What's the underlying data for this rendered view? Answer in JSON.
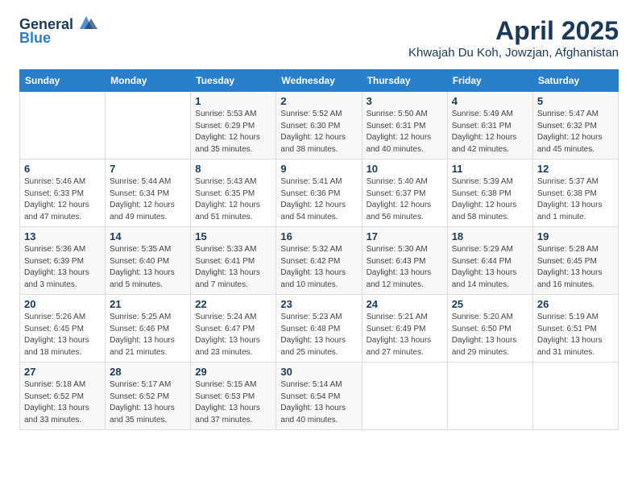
{
  "logo": {
    "general": "General",
    "blue": "Blue"
  },
  "title": {
    "month": "April 2025",
    "location": "Khwajah Du Koh, Jowzjan, Afghanistan"
  },
  "weekdays": [
    "Sunday",
    "Monday",
    "Tuesday",
    "Wednesday",
    "Thursday",
    "Friday",
    "Saturday"
  ],
  "weeks": [
    [
      {
        "day": "",
        "detail": ""
      },
      {
        "day": "",
        "detail": ""
      },
      {
        "day": "1",
        "detail": "Sunrise: 5:53 AM\nSunset: 6:29 PM\nDaylight: 12 hours\nand 35 minutes."
      },
      {
        "day": "2",
        "detail": "Sunrise: 5:52 AM\nSunset: 6:30 PM\nDaylight: 12 hours\nand 38 minutes."
      },
      {
        "day": "3",
        "detail": "Sunrise: 5:50 AM\nSunset: 6:31 PM\nDaylight: 12 hours\nand 40 minutes."
      },
      {
        "day": "4",
        "detail": "Sunrise: 5:49 AM\nSunset: 6:31 PM\nDaylight: 12 hours\nand 42 minutes."
      },
      {
        "day": "5",
        "detail": "Sunrise: 5:47 AM\nSunset: 6:32 PM\nDaylight: 12 hours\nand 45 minutes."
      }
    ],
    [
      {
        "day": "6",
        "detail": "Sunrise: 5:46 AM\nSunset: 6:33 PM\nDaylight: 12 hours\nand 47 minutes."
      },
      {
        "day": "7",
        "detail": "Sunrise: 5:44 AM\nSunset: 6:34 PM\nDaylight: 12 hours\nand 49 minutes."
      },
      {
        "day": "8",
        "detail": "Sunrise: 5:43 AM\nSunset: 6:35 PM\nDaylight: 12 hours\nand 51 minutes."
      },
      {
        "day": "9",
        "detail": "Sunrise: 5:41 AM\nSunset: 6:36 PM\nDaylight: 12 hours\nand 54 minutes."
      },
      {
        "day": "10",
        "detail": "Sunrise: 5:40 AM\nSunset: 6:37 PM\nDaylight: 12 hours\nand 56 minutes."
      },
      {
        "day": "11",
        "detail": "Sunrise: 5:39 AM\nSunset: 6:38 PM\nDaylight: 12 hours\nand 58 minutes."
      },
      {
        "day": "12",
        "detail": "Sunrise: 5:37 AM\nSunset: 6:38 PM\nDaylight: 13 hours\nand 1 minute."
      }
    ],
    [
      {
        "day": "13",
        "detail": "Sunrise: 5:36 AM\nSunset: 6:39 PM\nDaylight: 13 hours\nand 3 minutes."
      },
      {
        "day": "14",
        "detail": "Sunrise: 5:35 AM\nSunset: 6:40 PM\nDaylight: 13 hours\nand 5 minutes."
      },
      {
        "day": "15",
        "detail": "Sunrise: 5:33 AM\nSunset: 6:41 PM\nDaylight: 13 hours\nand 7 minutes."
      },
      {
        "day": "16",
        "detail": "Sunrise: 5:32 AM\nSunset: 6:42 PM\nDaylight: 13 hours\nand 10 minutes."
      },
      {
        "day": "17",
        "detail": "Sunrise: 5:30 AM\nSunset: 6:43 PM\nDaylight: 13 hours\nand 12 minutes."
      },
      {
        "day": "18",
        "detail": "Sunrise: 5:29 AM\nSunset: 6:44 PM\nDaylight: 13 hours\nand 14 minutes."
      },
      {
        "day": "19",
        "detail": "Sunrise: 5:28 AM\nSunset: 6:45 PM\nDaylight: 13 hours\nand 16 minutes."
      }
    ],
    [
      {
        "day": "20",
        "detail": "Sunrise: 5:26 AM\nSunset: 6:45 PM\nDaylight: 13 hours\nand 18 minutes."
      },
      {
        "day": "21",
        "detail": "Sunrise: 5:25 AM\nSunset: 6:46 PM\nDaylight: 13 hours\nand 21 minutes."
      },
      {
        "day": "22",
        "detail": "Sunrise: 5:24 AM\nSunset: 6:47 PM\nDaylight: 13 hours\nand 23 minutes."
      },
      {
        "day": "23",
        "detail": "Sunrise: 5:23 AM\nSunset: 6:48 PM\nDaylight: 13 hours\nand 25 minutes."
      },
      {
        "day": "24",
        "detail": "Sunrise: 5:21 AM\nSunset: 6:49 PM\nDaylight: 13 hours\nand 27 minutes."
      },
      {
        "day": "25",
        "detail": "Sunrise: 5:20 AM\nSunset: 6:50 PM\nDaylight: 13 hours\nand 29 minutes."
      },
      {
        "day": "26",
        "detail": "Sunrise: 5:19 AM\nSunset: 6:51 PM\nDaylight: 13 hours\nand 31 minutes."
      }
    ],
    [
      {
        "day": "27",
        "detail": "Sunrise: 5:18 AM\nSunset: 6:52 PM\nDaylight: 13 hours\nand 33 minutes."
      },
      {
        "day": "28",
        "detail": "Sunrise: 5:17 AM\nSunset: 6:52 PM\nDaylight: 13 hours\nand 35 minutes."
      },
      {
        "day": "29",
        "detail": "Sunrise: 5:15 AM\nSunset: 6:53 PM\nDaylight: 13 hours\nand 37 minutes."
      },
      {
        "day": "30",
        "detail": "Sunrise: 5:14 AM\nSunset: 6:54 PM\nDaylight: 13 hours\nand 40 minutes."
      },
      {
        "day": "",
        "detail": ""
      },
      {
        "day": "",
        "detail": ""
      },
      {
        "day": "",
        "detail": ""
      }
    ]
  ]
}
